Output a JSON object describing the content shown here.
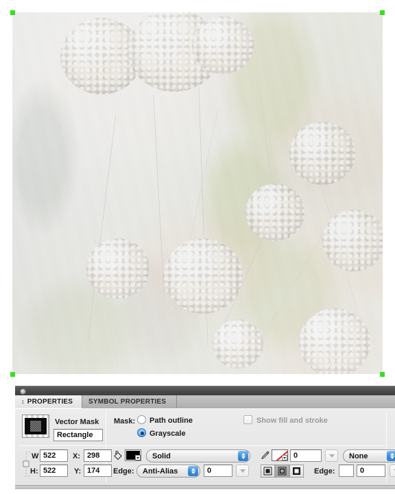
{
  "window": {
    "canvas_bg": "#ffffff",
    "selection_handle_color": "#35e11f"
  },
  "artwork": {
    "name": "flower-photo",
    "description": "Washed-out noisy photograph of round billy-button flower heads on slender stems",
    "selected": true
  },
  "panel": {
    "tabs": [
      {
        "label": "PROPERTIES",
        "active": true,
        "grip": "↕"
      },
      {
        "label": "SYMBOL PROPERTIES",
        "active": false,
        "grip": ""
      }
    ],
    "object": {
      "type_label": "Vector Mask",
      "name_value": "Rectangle",
      "thumbnail": "mask-thumbnail"
    },
    "mask": {
      "label": "Mask:",
      "options": [
        {
          "label": "Path outline",
          "selected": false
        },
        {
          "label": "Grayscale",
          "selected": true
        }
      ]
    },
    "show_fill_and_stroke": {
      "label": "Show fill and stroke",
      "checked": false,
      "enabled": false
    },
    "geometry": {
      "w_label": "W",
      "w_value": "522",
      "h_label": "H:",
      "h_value": "522",
      "x_label": "X:",
      "x_value": "298",
      "y_label": "Y:",
      "y_value": "174"
    },
    "fill": {
      "bucket_icon": "paint-bucket-icon",
      "color": "#000000",
      "type_value": "Solid",
      "edge_label": "Edge:",
      "edge_value": "Anti-Alias",
      "edge_amount": "0"
    },
    "stroke": {
      "pencil_icon": "pencil-icon",
      "color": "none",
      "width_value": "0",
      "category_value": "None",
      "alignment": [
        {
          "name": "stroke-align-inside",
          "selected": false
        },
        {
          "name": "stroke-align-center",
          "selected": true
        },
        {
          "name": "stroke-align-outside",
          "selected": false
        }
      ],
      "edge_label": "Edge:",
      "edge_color": "#ffffff",
      "edge_amount": "0"
    }
  }
}
